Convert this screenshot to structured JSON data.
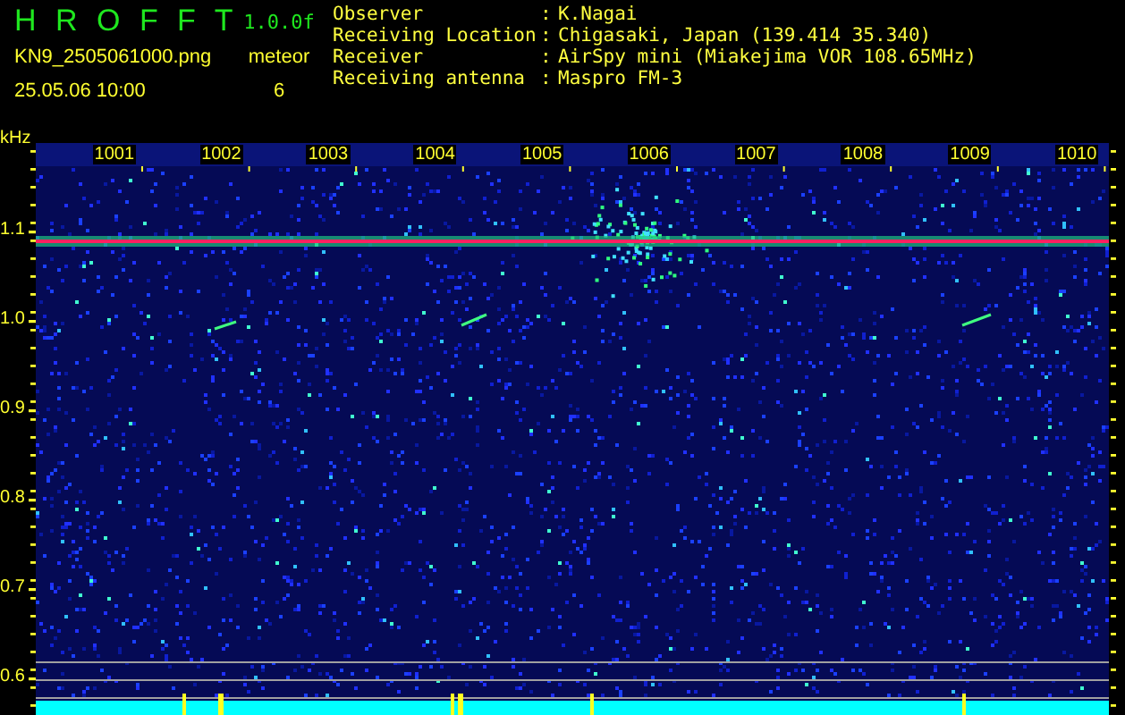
{
  "header": {
    "title": "H R O F F T",
    "version": "1.0.0f",
    "filename": "KN9_2505061000.png",
    "timestamp": "25.05.06 10:00",
    "meteor_label": "meteor",
    "meteor_count": "6"
  },
  "info": [
    {
      "label": "Observer",
      "separator": ":",
      "value": "K.Nagai"
    },
    {
      "label": "Receiving Location",
      "separator": ":",
      "value": "Chigasaki, Japan (139.414 35.340)"
    },
    {
      "label": "Receiver",
      "separator": ":",
      "value": "AirSpy mini (Miakejima VOR 108.65MHz)"
    },
    {
      "label": "Receiving antenna",
      "separator": ":",
      "value": "Maspro FM-3"
    }
  ],
  "spectrogram": {
    "unit": "kHz",
    "y_ticks": [
      "1.1",
      "1.0",
      "0.9",
      "0.8",
      "0.7",
      "0.6"
    ],
    "x_labels": [
      "1001",
      "1002",
      "1003",
      "1004",
      "1005",
      "1006",
      "1007",
      "1008",
      "1009",
      "1010"
    ]
  }
}
